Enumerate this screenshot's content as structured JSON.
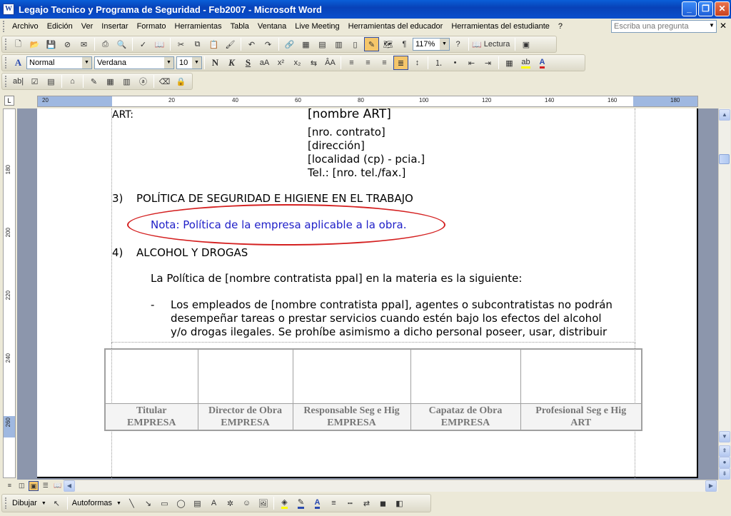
{
  "window": {
    "title": "Legajo Tecnico y Programa de Seguridad - Feb2007 - Microsoft Word",
    "app_icon": "W",
    "minimize": "_",
    "restore": "❐",
    "close": "✕"
  },
  "menu": {
    "items": [
      "Archivo",
      "Edición",
      "Ver",
      "Insertar",
      "Formato",
      "Herramientas",
      "Tabla",
      "Ventana",
      "Live Meeting",
      "Herramientas del educador",
      "Herramientas del estudiante",
      "?"
    ],
    "help_placeholder": "Escriba una pregunta",
    "close_doc": "✕"
  },
  "toolbar_standard": {
    "zoom": "117%",
    "reading_label": "Lectura"
  },
  "toolbar_format": {
    "style": "Normal",
    "font": "Verdana",
    "size": "10",
    "bold": "N",
    "italic": "K",
    "underline": "S"
  },
  "ruler": {
    "h_ticks": [
      "20",
      "20",
      "40",
      "60",
      "80",
      "100",
      "120",
      "140",
      "160",
      "180"
    ],
    "v_ticks": [
      "180",
      "200",
      "220",
      "240",
      "260"
    ],
    "tab_marker": "L"
  },
  "document": {
    "art_label": "ART:",
    "art_name": "[nombre ART]",
    "art_lines": [
      "[nro. contrato]",
      "[dirección]",
      "[localidad (cp) - pcia.]",
      "Tel.: [nro. tel./fax.]"
    ],
    "section3_num": "3)",
    "section3_title": "POLÍTICA DE SEGURIDAD E HIGIENE EN EL TRABAJO",
    "note": "Nota: Política de la empresa aplicable a la obra.",
    "section4_num": "4)",
    "section4_title": "ALCOHOL Y DROGAS",
    "body": "La Política de [nombre contratista ppal] en la materia es la siguiente:",
    "bullet_dash": "-",
    "bullet_lines": [
      "Los empleados de [nombre contratista ppal], agentes o subcontratistas no podrán",
      "desempeñar tareas o prestar servicios cuando estén bajo los efectos del alcohol",
      "y/o drogas ilegales. Se prohíbe asimismo a dicho personal poseer, usar, distribuir"
    ]
  },
  "signature_table": {
    "columns": [
      {
        "role": "Titular",
        "org": "EMPRESA"
      },
      {
        "role": "Director de Obra",
        "org": "EMPRESA"
      },
      {
        "role": "Responsable Seg e Hig",
        "org": "EMPRESA"
      },
      {
        "role": "Capataz de Obra",
        "org": "EMPRESA"
      },
      {
        "role": "Profesional Seg e Hig",
        "org": "ART"
      }
    ]
  },
  "drawing_toolbar": {
    "draw_label": "Dibujar",
    "autoshapes_label": "Autoformas"
  },
  "colors": {
    "title_bar": "#0a4fcc",
    "note_text": "#2020c8",
    "highlight_oval": "#d42020",
    "doc_background": "#8c96ac"
  }
}
